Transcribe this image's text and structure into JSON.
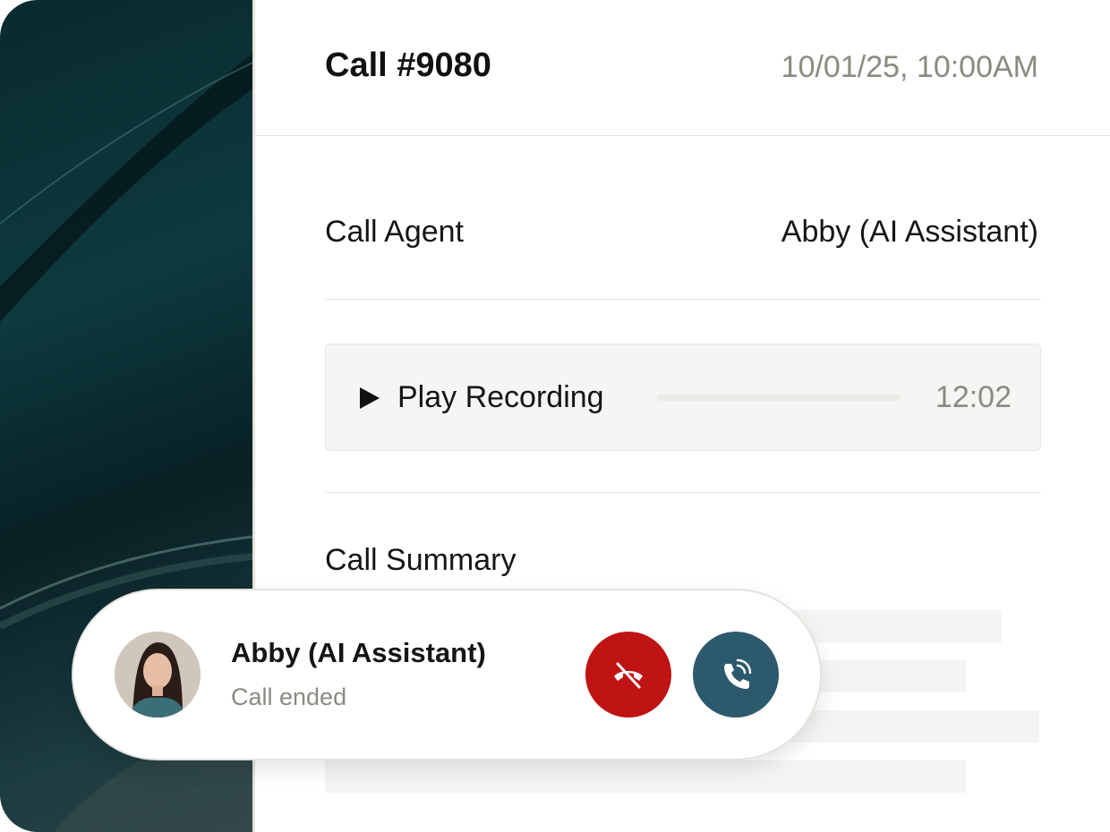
{
  "call": {
    "title": "Call #9080",
    "datetime": "10/01/25, 10:00AM"
  },
  "agent": {
    "label": "Call Agent",
    "value": "Abby (AI Assistant)"
  },
  "recording": {
    "label": "Play Recording",
    "duration": "12:02",
    "progress_fraction": 0,
    "icon": "play-icon"
  },
  "summary": {
    "title": "Call Summary"
  },
  "caller_card": {
    "name": "Abby (AI Assistant)",
    "status": "Call ended",
    "hangup_icon": "phone-off-icon",
    "call_icon": "phone-ringing-icon"
  },
  "colors": {
    "hangup": "#c01313",
    "call": "#2c5a6c",
    "muted_text": "#8c8a7f",
    "background_panel": "#0d3a3f"
  }
}
